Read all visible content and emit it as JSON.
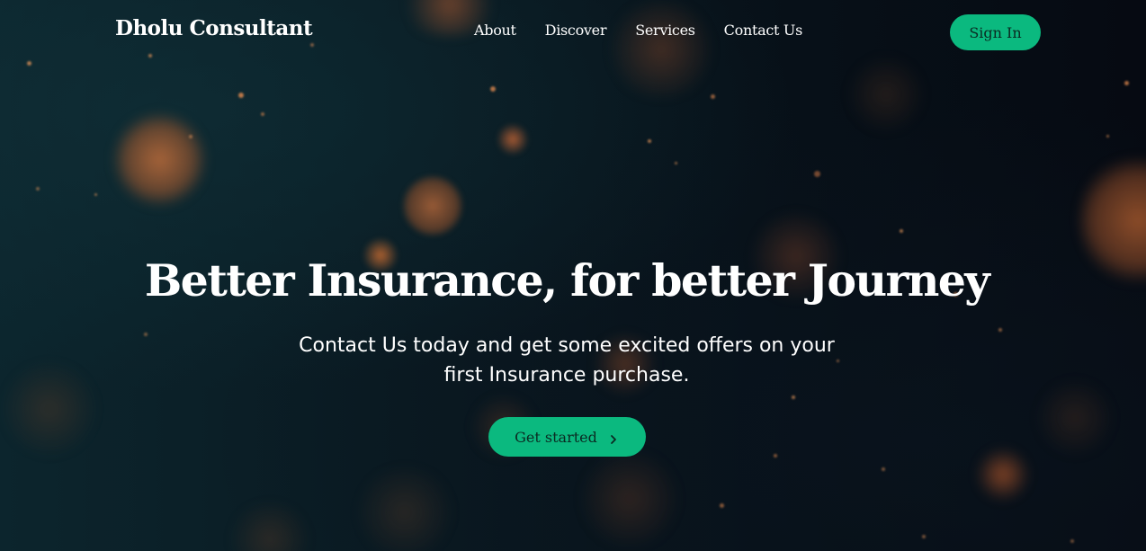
{
  "brand": {
    "name": "Dholu Consultant"
  },
  "nav": {
    "links": [
      {
        "label": "About"
      },
      {
        "label": "Discover"
      },
      {
        "label": "Services"
      },
      {
        "label": "Contact Us"
      }
    ],
    "signin_label": "Sign In"
  },
  "hero": {
    "title": "Better Insurance, for better Journey",
    "subtitle": "Contact Us today and get some excited offers on your first Insurance purchase.",
    "cta_label": "Get started",
    "cta_icon": "chevron-right-icon"
  },
  "colors": {
    "accent": "#0bb97f",
    "accent_text": "#0b2a22",
    "background_dark": "#071018",
    "bokeh_orange": "#c8642d"
  }
}
